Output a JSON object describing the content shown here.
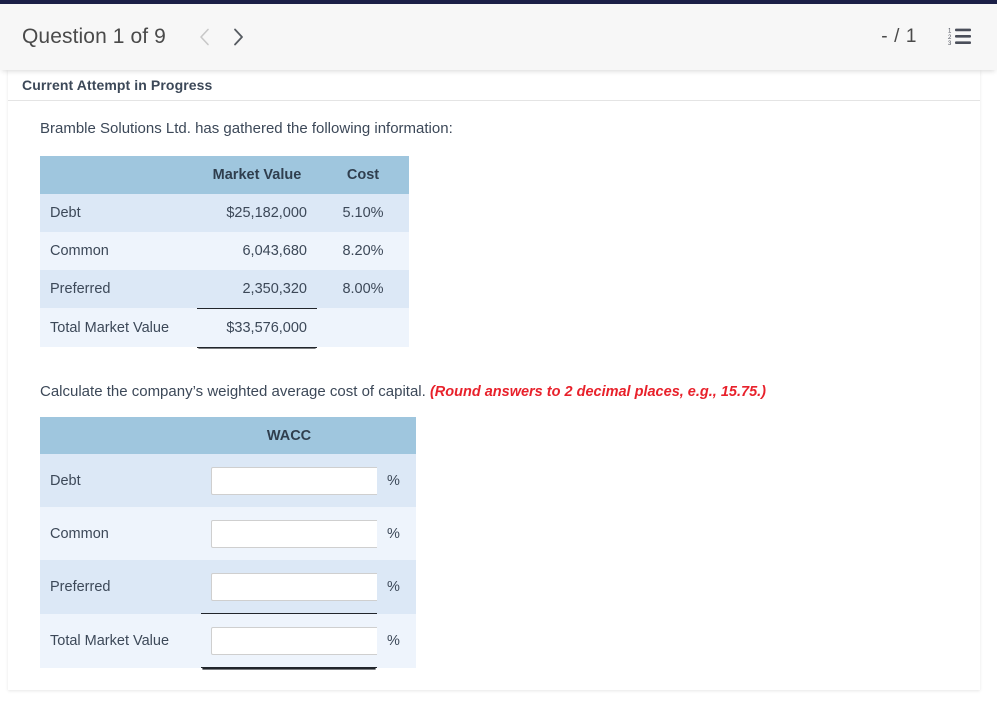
{
  "header": {
    "question_title": "Question 1 of 9",
    "prev_icon": "chevron-left-icon",
    "next_icon": "chevron-right-icon",
    "score": "- / 1",
    "list_icon": "numbered-list-icon"
  },
  "card": {
    "attempt_status": "Current Attempt in Progress",
    "intro_text": "Bramble Solutions Ltd. has gathered the following information:",
    "question_text": "Calculate the company’s weighted average cost of capital.",
    "round_note": "(Round answers to 2 decimal places, e.g., 15.75.)"
  },
  "market_table": {
    "headers": [
      "",
      "Market Value",
      "Cost"
    ],
    "rows": [
      {
        "label": "Debt",
        "market_value": "$25,182,000",
        "cost": "5.10%"
      },
      {
        "label": "Common",
        "market_value": "6,043,680",
        "cost": "8.20%"
      },
      {
        "label": "Preferred",
        "market_value": "2,350,320",
        "cost": "8.00%"
      },
      {
        "label": "Total Market Value",
        "market_value": "$33,576,000",
        "cost": ""
      }
    ]
  },
  "wacc_table": {
    "headers": [
      "",
      "WACC",
      ""
    ],
    "percent_symbol": "%",
    "input_placeholder": "",
    "rows": [
      {
        "label": "Debt",
        "value": ""
      },
      {
        "label": "Common",
        "value": ""
      },
      {
        "label": "Preferred",
        "value": ""
      },
      {
        "label": "Total Market Value",
        "value": ""
      }
    ]
  },
  "colors": {
    "top_strip": "#1b1f47",
    "table_header": "#9fc6de",
    "row_odd": "#dce8f6",
    "row_even": "#eef4fc",
    "note_red": "#e8212b",
    "text": "#3c4858"
  }
}
